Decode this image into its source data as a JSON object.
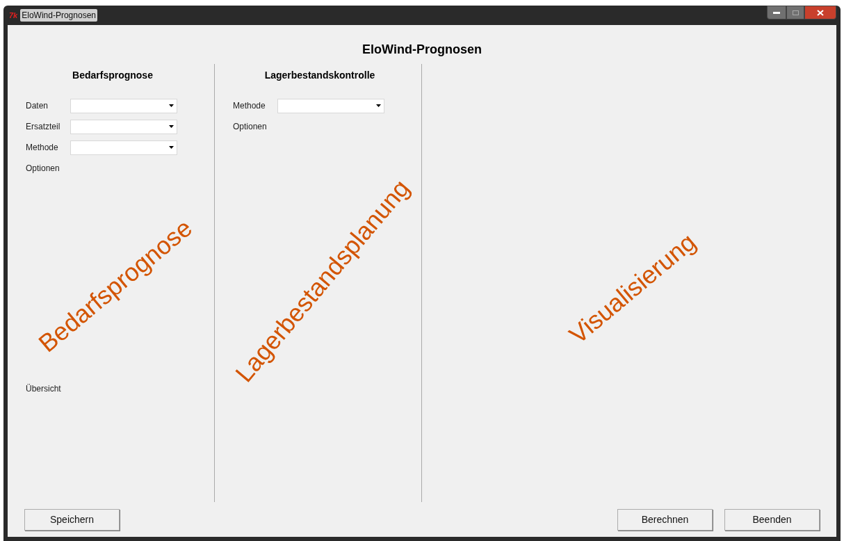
{
  "window": {
    "title": "EloWind-Prognosen",
    "app_icon": "7k"
  },
  "heading": "EloWind-Prognosen",
  "columns": [
    {
      "title": "Bedarfsprognose",
      "fields": [
        {
          "label": "Daten"
        },
        {
          "label": "Ersatzteil"
        },
        {
          "label": "Methode"
        }
      ],
      "labels": [
        "Optionen"
      ],
      "footer_label": "Übersicht"
    },
    {
      "title": "Lagerbestandskontrolle",
      "fields": [
        {
          "label": "Methode"
        }
      ],
      "labels": [
        "Optionen"
      ]
    }
  ],
  "annotations": [
    {
      "text": "Bedarfsprognose"
    },
    {
      "text": "Lagerbestandsplanung"
    },
    {
      "text": "Visualisierung"
    }
  ],
  "buttons_left": [
    "Speichern"
  ],
  "buttons_right": [
    "Berechnen",
    "Beenden"
  ]
}
